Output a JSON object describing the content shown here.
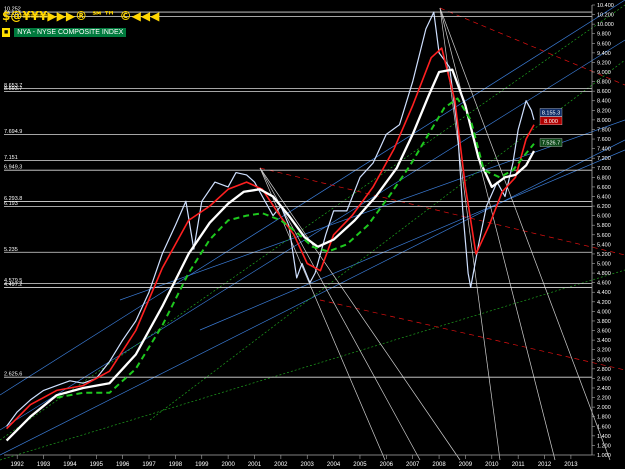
{
  "toolbar": {
    "glyphs": "$@¥¥¥▶▶▶®   ℠™   ©◀◀◀"
  },
  "legend": {
    "symbol": "■",
    "label": "NYA - NYSE COMPOSITE INDEX"
  },
  "chart_data": {
    "type": "line",
    "title": "NYA - NYSE COMPOSITE INDEX",
    "x_ticks": [
      "1992",
      "1993",
      "1994",
      "1995",
      "1996",
      "1997",
      "1998",
      "1999",
      "2000",
      "2001",
      "2002",
      "2003",
      "2004",
      "2005",
      "2006",
      "2007",
      "2008",
      "2009",
      "2010",
      "2011",
      "2012",
      "2013"
    ],
    "y_ticks": [
      "10.400",
      "10.200",
      "10.000",
      "9.800",
      "9.600",
      "9.400",
      "9.200",
      "9.000",
      "8.800",
      "8.600",
      "8.400",
      "8.200",
      "8.000",
      "7.800",
      "7.600",
      "7.400",
      "7.200",
      "7.000",
      "6.800",
      "6.600",
      "6.400",
      "6.200",
      "6.000",
      "5.800",
      "5.600",
      "5.400",
      "5.200",
      "5.000",
      "4.800",
      "4.600",
      "4.400",
      "4.200",
      "4.000",
      "3.800",
      "3.600",
      "3.400",
      "3.200",
      "3.000",
      "2.800",
      "2.600",
      "2.400",
      "2.200",
      "2.000",
      "1.800",
      "1.600",
      "1.400",
      "1.200",
      "1.000"
    ],
    "ylim": [
      1.0,
      10.4
    ],
    "xlim": [
      1991.5,
      2013.8
    ],
    "horizontal_levels": [
      {
        "label": "10.252",
        "value": 10.252
      },
      {
        "label": "10.162",
        "value": 10.162
      },
      {
        "label": "8.653.7",
        "value": 8.6537
      },
      {
        "label": "8.593.7",
        "value": 8.5937
      },
      {
        "label": "7.694.9",
        "value": 7.6949
      },
      {
        "label": "7.151",
        "value": 7.151
      },
      {
        "label": "6.949.3",
        "value": 6.9493
      },
      {
        "label": "6.293.8",
        "value": 6.2938
      },
      {
        "label": "6.193",
        "value": 6.193
      },
      {
        "label": "5.235",
        "value": 5.235
      },
      {
        "label": "4.579.5",
        "value": 4.5795
      },
      {
        "label": "4.497.2",
        "value": 4.4972
      },
      {
        "label": "2.625.6",
        "value": 2.6256
      }
    ],
    "right_badges": [
      {
        "label": "8.155.3",
        "value": 8.1553,
        "color": "#0e2c66"
      },
      {
        "label": "8.000",
        "value": 7.98,
        "color": "#b00000"
      },
      {
        "label": "7.526.7",
        "value": 7.5267,
        "color": "#0e4a1a"
      }
    ],
    "series": [
      {
        "color": "#cfe0ff",
        "style": "price",
        "x": [
          1991.6,
          1992.0,
          1992.5,
          1993.0,
          1993.5,
          1994.0,
          1994.5,
          1995.0,
          1995.5,
          1996.0,
          1996.5,
          1997.0,
          1997.5,
          1998.0,
          1998.4,
          1998.7,
          1999.0,
          1999.5,
          2000.0,
          2000.3,
          2000.7,
          2001.0,
          2001.3,
          2001.7,
          2002.0,
          2002.3,
          2002.6,
          2002.8,
          2003.1,
          2003.3,
          2003.7,
          2004.0,
          2004.5,
          2005.0,
          2005.5,
          2006.0,
          2006.5,
          2007.0,
          2007.5,
          2007.8,
          2008.0,
          2008.4,
          2008.7,
          2008.9,
          2009.1,
          2009.2,
          2009.5,
          2009.8,
          2010.2,
          2010.5,
          2010.8,
          2011.0,
          2011.3,
          2011.5,
          2011.6
        ],
        "y": [
          1.6,
          1.9,
          2.15,
          2.35,
          2.45,
          2.55,
          2.5,
          2.6,
          2.95,
          3.4,
          3.8,
          4.4,
          5.2,
          5.8,
          6.3,
          5.3,
          6.3,
          6.7,
          6.6,
          6.9,
          6.85,
          6.7,
          6.4,
          6.0,
          6.2,
          5.8,
          4.7,
          5.0,
          4.6,
          4.8,
          5.6,
          6.1,
          6.1,
          6.8,
          7.1,
          7.7,
          7.9,
          8.8,
          9.9,
          10.25,
          9.4,
          9.1,
          7.8,
          6.1,
          4.8,
          4.5,
          5.4,
          6.2,
          6.7,
          6.4,
          7.1,
          7.8,
          8.4,
          8.2,
          8.0
        ]
      },
      {
        "color": "#ff2020",
        "style": "ma-short",
        "x": [
          1991.6,
          1992.5,
          1993.5,
          1994.5,
          1995.5,
          1996.5,
          1997.5,
          1998.5,
          1999.3,
          2000.0,
          2000.7,
          2001.3,
          2001.9,
          2002.5,
          2003.0,
          2003.5,
          2004.0,
          2004.7,
          2005.5,
          2006.3,
          2007.0,
          2007.7,
          2008.1,
          2008.6,
          2009.0,
          2009.4,
          2009.9,
          2010.4,
          2010.9,
          2011.3,
          2011.6
        ],
        "y": [
          1.55,
          2.05,
          2.35,
          2.45,
          2.75,
          3.6,
          4.9,
          5.9,
          6.2,
          6.55,
          6.7,
          6.55,
          6.05,
          5.6,
          5.0,
          4.85,
          5.6,
          6.0,
          6.6,
          7.4,
          8.3,
          9.3,
          9.5,
          8.4,
          6.6,
          5.2,
          5.8,
          6.5,
          6.8,
          7.6,
          7.9
        ]
      },
      {
        "color": "#ffffff",
        "style": "ma-long",
        "x": [
          1991.6,
          1992.5,
          1993.5,
          1994.5,
          1995.5,
          1996.5,
          1997.5,
          1998.5,
          1999.3,
          2000.0,
          2000.6,
          2001.2,
          2001.7,
          2002.3,
          2002.9,
          2003.4,
          2004.0,
          2004.8,
          2005.6,
          2006.4,
          2007.0,
          2007.6,
          2008.0,
          2008.5,
          2009.0,
          2009.5,
          2010.0,
          2010.5,
          2010.9,
          2011.3,
          2011.6
        ],
        "y": [
          1.3,
          1.8,
          2.25,
          2.4,
          2.5,
          3.1,
          4.1,
          5.2,
          5.85,
          6.25,
          6.5,
          6.55,
          6.4,
          6.0,
          5.55,
          5.35,
          5.5,
          5.9,
          6.4,
          7.0,
          7.7,
          8.5,
          9.0,
          9.05,
          8.3,
          7.2,
          6.6,
          6.8,
          6.85,
          7.05,
          7.35
        ]
      },
      {
        "color": "#1ec81e",
        "style": "ma-dashed",
        "x": [
          1993.5,
          1994.5,
          1995.5,
          1996.5,
          1997.5,
          1998.5,
          1999.3,
          2000.0,
          2000.7,
          2001.3,
          2002.0,
          2002.6,
          2003.2,
          2003.8,
          2004.5,
          2005.3,
          2006.1,
          2006.9,
          2007.6,
          2008.2,
          2008.7,
          2009.2,
          2009.7,
          2010.3,
          2010.8,
          2011.3,
          2011.6
        ],
        "y": [
          2.2,
          2.3,
          2.3,
          2.8,
          3.7,
          4.8,
          5.5,
          5.9,
          6.0,
          6.05,
          5.9,
          5.65,
          5.35,
          5.25,
          5.4,
          5.8,
          6.4,
          7.05,
          7.7,
          8.25,
          8.45,
          8.0,
          6.95,
          6.8,
          6.95,
          7.3,
          7.5
        ]
      }
    ]
  }
}
